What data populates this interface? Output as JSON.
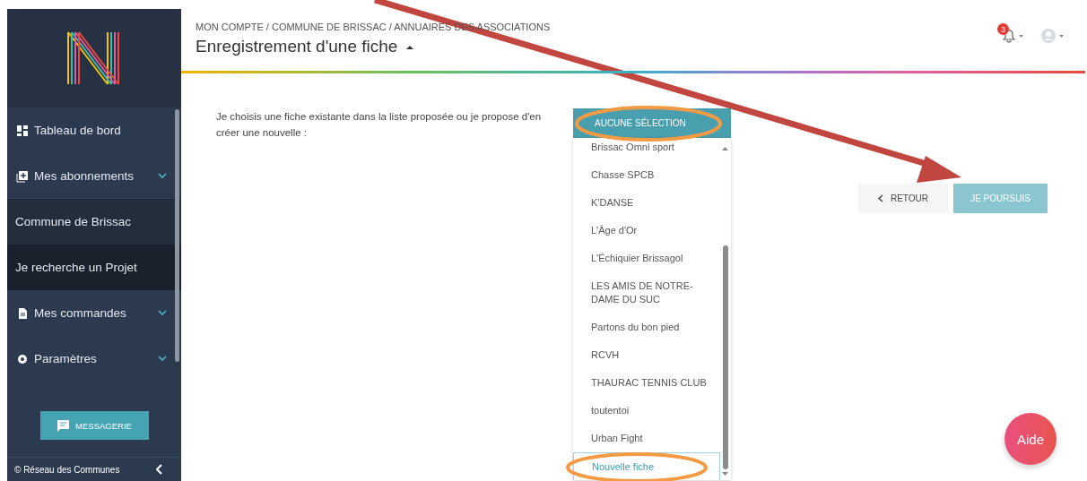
{
  "sidebar": {
    "menu": [
      {
        "label": "Tableau de bord",
        "kind": "section",
        "expandable": false,
        "selected": false
      },
      {
        "label": "Mes abonnements",
        "kind": "section",
        "expandable": true,
        "selected": false
      },
      {
        "label": "Commune de Brissac",
        "kind": "sub",
        "expandable": false,
        "selected": false
      },
      {
        "label": "Je recherche un Projet",
        "kind": "sub",
        "expandable": false,
        "selected": true
      },
      {
        "label": "Mes commandes",
        "kind": "section",
        "expandable": true,
        "selected": false
      },
      {
        "label": "Paramètres",
        "kind": "section",
        "expandable": true,
        "selected": false
      }
    ],
    "messaging_button": "MESSAGERIE",
    "footer": "© Réseau des Communes"
  },
  "header": {
    "breadcrumb": "MON COMPTE / COMMUNE DE BRISSAC / ANNUAIRES DES ASSOCIATIONS",
    "title": "Enregistrement d'une fiche",
    "notification_count": "3"
  },
  "form": {
    "instruction": "Je choisis une fiche existante dans la liste proposée ou je propose d'en créer une nouvelle :",
    "dropdown": {
      "header": "AUCUNE SÉLECTION",
      "options": [
        {
          "label": "Brissac Omni sport",
          "selected": false
        },
        {
          "label": "Chasse SPCB",
          "selected": false
        },
        {
          "label": "K'DANSE",
          "selected": false
        },
        {
          "label": "L'Âge d'Or",
          "selected": false
        },
        {
          "label": "L'Échiquier Brissagol",
          "selected": false
        },
        {
          "label": "LES AMIS DE NOTRE-DAME DU SUC",
          "selected": false
        },
        {
          "label": "Partons du bon pied",
          "selected": false
        },
        {
          "label": "RCVH",
          "selected": false
        },
        {
          "label": "THAURAC TENNIS CLUB",
          "selected": false
        },
        {
          "label": "toutentoi",
          "selected": false
        },
        {
          "label": "Urban Fight",
          "selected": false
        },
        {
          "label": "Nouvelle fiche",
          "selected": true
        }
      ]
    },
    "buttons": [
      {
        "label": "RETOUR",
        "kind": "back",
        "disabled": false
      },
      {
        "label": "JE POURSUIS",
        "kind": "primary",
        "disabled": true
      }
    ]
  },
  "help_button": "Aide",
  "annotations": [
    {
      "kind": "arrow"
    },
    {
      "kind": "ellipse"
    },
    {
      "kind": "ellipse"
    }
  ]
}
